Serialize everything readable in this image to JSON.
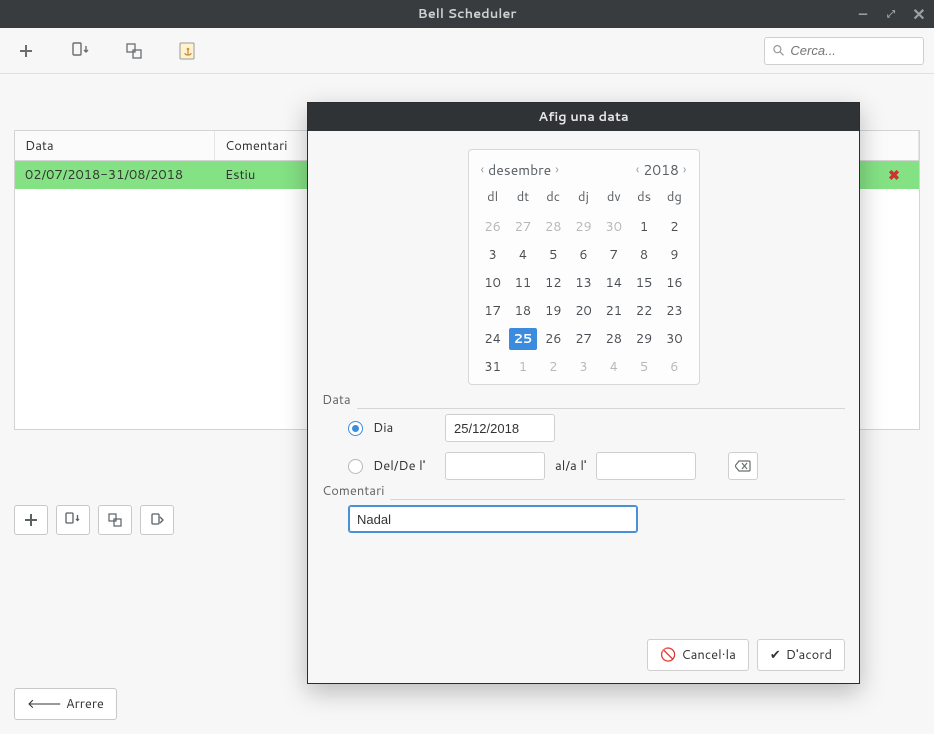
{
  "window": {
    "title": "Bell Scheduler"
  },
  "search": {
    "placeholder": "Cerca..."
  },
  "table": {
    "headers": {
      "data": "Data",
      "comment": "Comentari"
    },
    "rows": [
      {
        "data": "02/07/2018-31/08/2018",
        "comment": "Estiu"
      }
    ]
  },
  "back_label": "Arrere",
  "modal": {
    "title": "Afig una data",
    "month_label": "desembre",
    "year_label": "2018",
    "dow": [
      "dl",
      "dt",
      "dc",
      "dj",
      "dv",
      "ds",
      "dg"
    ],
    "leading_other": [
      26,
      27,
      28,
      29,
      30
    ],
    "days": [
      1,
      2,
      3,
      4,
      5,
      6,
      7,
      8,
      9,
      10,
      11,
      12,
      13,
      14,
      15,
      16,
      17,
      18,
      19,
      20,
      21,
      22,
      23,
      24,
      25,
      26,
      27,
      28,
      29,
      30,
      31
    ],
    "trailing_other": [
      1,
      2,
      3,
      4,
      5,
      6
    ],
    "selected_day": 25,
    "data_legend": "Data",
    "radio_day_label": "Dia",
    "radio_range_label": "Del/De l'",
    "range_mid_label": "al/a l'",
    "date_value": "25/12/2018",
    "range_from": "",
    "range_to": "",
    "comment_legend": "Comentari",
    "comment_value": "Nadal",
    "cancel_label": "Cancel·la",
    "ok_label": "D'acord"
  }
}
